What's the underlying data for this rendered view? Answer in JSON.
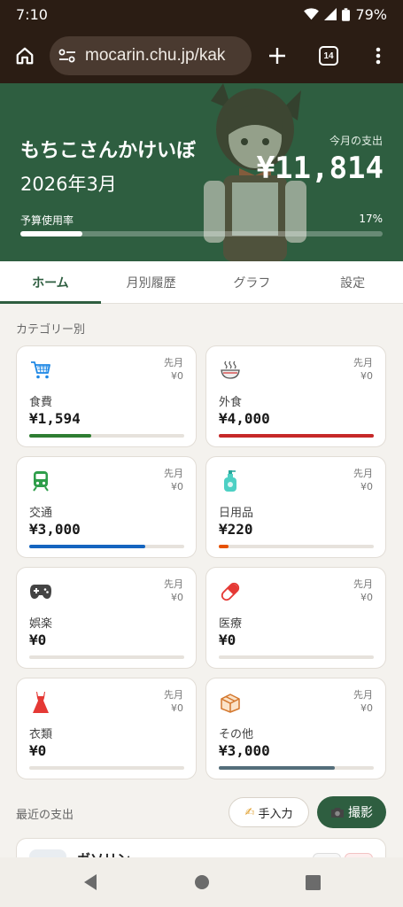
{
  "status_bar": {
    "time": "7:10",
    "battery": "79%"
  },
  "browser": {
    "url": "mocarin.chu.jp/kak",
    "tab_count": "14"
  },
  "hero": {
    "title": "もちこさんかけいぼ",
    "month": "2026年3月",
    "spend_label": "今月の支出",
    "spend_amount": "¥11,814",
    "budget_label": "予算使用率",
    "budget_percent_label": "17%",
    "budget_fraction": 0.17
  },
  "tabs": [
    {
      "label": "ホーム",
      "active": true
    },
    {
      "label": "月別履歴",
      "active": false
    },
    {
      "label": "グラフ",
      "active": false
    },
    {
      "label": "設定",
      "active": false
    }
  ],
  "category_section_label": "カテゴリー別",
  "categories": [
    {
      "name": "食費",
      "amount": "¥1,594",
      "prev_label": "先月",
      "prev_amount": "¥0",
      "icon": "cart-icon",
      "color": "#2e7d32",
      "fill": 0.4
    },
    {
      "name": "外食",
      "amount": "¥4,000",
      "prev_label": "先月",
      "prev_amount": "¥0",
      "icon": "bowl-icon",
      "color": "#c62828",
      "fill": 1.0
    },
    {
      "name": "交通",
      "amount": "¥3,000",
      "prev_label": "先月",
      "prev_amount": "¥0",
      "icon": "train-icon",
      "color": "#1565c0",
      "fill": 0.75
    },
    {
      "name": "日用品",
      "amount": "¥220",
      "prev_label": "先月",
      "prev_amount": "¥0",
      "icon": "soap-bottle-icon",
      "color": "#e65100",
      "fill": 0.06
    },
    {
      "name": "娯楽",
      "amount": "¥0",
      "prev_label": "先月",
      "prev_amount": "¥0",
      "icon": "gamepad-icon",
      "color": "#616161",
      "fill": 0
    },
    {
      "name": "医療",
      "amount": "¥0",
      "prev_label": "先月",
      "prev_amount": "¥0",
      "icon": "pill-icon",
      "color": "#d32f2f",
      "fill": 0
    },
    {
      "name": "衣類",
      "amount": "¥0",
      "prev_label": "先月",
      "prev_amount": "¥0",
      "icon": "dress-icon",
      "color": "#d32f2f",
      "fill": 0
    },
    {
      "name": "その他",
      "amount": "¥3,000",
      "prev_label": "先月",
      "prev_amount": "¥0",
      "icon": "package-icon",
      "color": "#546e7a",
      "fill": 0.75
    }
  ],
  "recent": {
    "section_label": "最近の支出",
    "manual_button": "手入力",
    "manual_icon": "✍",
    "photo_button": "撮影",
    "first_item_name": "ガソリン"
  },
  "colors": {
    "brand_green": "#2e5e40",
    "browser_chrome": "#2b1d14"
  }
}
